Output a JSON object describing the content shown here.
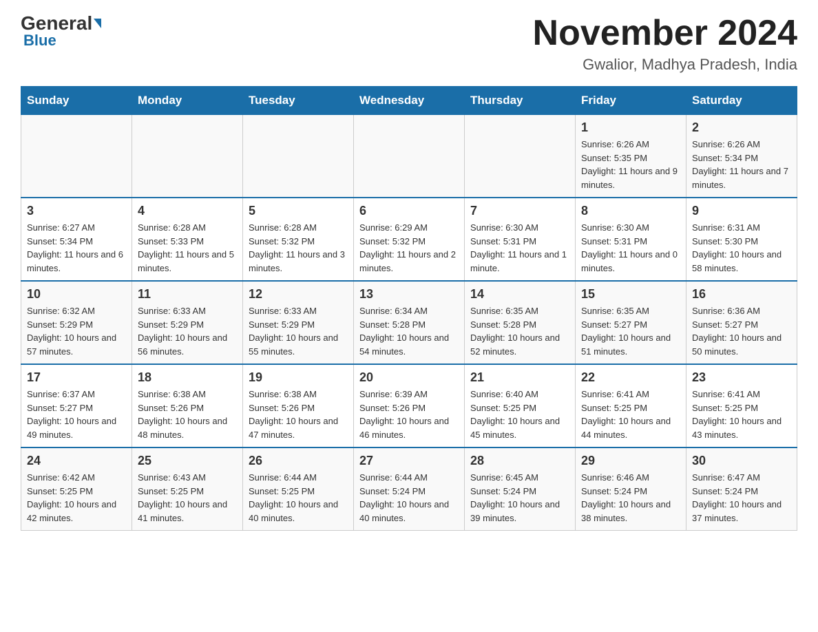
{
  "header": {
    "logo_general": "General",
    "logo_blue": "Blue",
    "month_title": "November 2024",
    "location": "Gwalior, Madhya Pradesh, India"
  },
  "days_of_week": [
    "Sunday",
    "Monday",
    "Tuesday",
    "Wednesday",
    "Thursday",
    "Friday",
    "Saturday"
  ],
  "weeks": [
    [
      {
        "day": "",
        "info": ""
      },
      {
        "day": "",
        "info": ""
      },
      {
        "day": "",
        "info": ""
      },
      {
        "day": "",
        "info": ""
      },
      {
        "day": "",
        "info": ""
      },
      {
        "day": "1",
        "info": "Sunrise: 6:26 AM\nSunset: 5:35 PM\nDaylight: 11 hours and 9 minutes."
      },
      {
        "day": "2",
        "info": "Sunrise: 6:26 AM\nSunset: 5:34 PM\nDaylight: 11 hours and 7 minutes."
      }
    ],
    [
      {
        "day": "3",
        "info": "Sunrise: 6:27 AM\nSunset: 5:34 PM\nDaylight: 11 hours and 6 minutes."
      },
      {
        "day": "4",
        "info": "Sunrise: 6:28 AM\nSunset: 5:33 PM\nDaylight: 11 hours and 5 minutes."
      },
      {
        "day": "5",
        "info": "Sunrise: 6:28 AM\nSunset: 5:32 PM\nDaylight: 11 hours and 3 minutes."
      },
      {
        "day": "6",
        "info": "Sunrise: 6:29 AM\nSunset: 5:32 PM\nDaylight: 11 hours and 2 minutes."
      },
      {
        "day": "7",
        "info": "Sunrise: 6:30 AM\nSunset: 5:31 PM\nDaylight: 11 hours and 1 minute."
      },
      {
        "day": "8",
        "info": "Sunrise: 6:30 AM\nSunset: 5:31 PM\nDaylight: 11 hours and 0 minutes."
      },
      {
        "day": "9",
        "info": "Sunrise: 6:31 AM\nSunset: 5:30 PM\nDaylight: 10 hours and 58 minutes."
      }
    ],
    [
      {
        "day": "10",
        "info": "Sunrise: 6:32 AM\nSunset: 5:29 PM\nDaylight: 10 hours and 57 minutes."
      },
      {
        "day": "11",
        "info": "Sunrise: 6:33 AM\nSunset: 5:29 PM\nDaylight: 10 hours and 56 minutes."
      },
      {
        "day": "12",
        "info": "Sunrise: 6:33 AM\nSunset: 5:29 PM\nDaylight: 10 hours and 55 minutes."
      },
      {
        "day": "13",
        "info": "Sunrise: 6:34 AM\nSunset: 5:28 PM\nDaylight: 10 hours and 54 minutes."
      },
      {
        "day": "14",
        "info": "Sunrise: 6:35 AM\nSunset: 5:28 PM\nDaylight: 10 hours and 52 minutes."
      },
      {
        "day": "15",
        "info": "Sunrise: 6:35 AM\nSunset: 5:27 PM\nDaylight: 10 hours and 51 minutes."
      },
      {
        "day": "16",
        "info": "Sunrise: 6:36 AM\nSunset: 5:27 PM\nDaylight: 10 hours and 50 minutes."
      }
    ],
    [
      {
        "day": "17",
        "info": "Sunrise: 6:37 AM\nSunset: 5:27 PM\nDaylight: 10 hours and 49 minutes."
      },
      {
        "day": "18",
        "info": "Sunrise: 6:38 AM\nSunset: 5:26 PM\nDaylight: 10 hours and 48 minutes."
      },
      {
        "day": "19",
        "info": "Sunrise: 6:38 AM\nSunset: 5:26 PM\nDaylight: 10 hours and 47 minutes."
      },
      {
        "day": "20",
        "info": "Sunrise: 6:39 AM\nSunset: 5:26 PM\nDaylight: 10 hours and 46 minutes."
      },
      {
        "day": "21",
        "info": "Sunrise: 6:40 AM\nSunset: 5:25 PM\nDaylight: 10 hours and 45 minutes."
      },
      {
        "day": "22",
        "info": "Sunrise: 6:41 AM\nSunset: 5:25 PM\nDaylight: 10 hours and 44 minutes."
      },
      {
        "day": "23",
        "info": "Sunrise: 6:41 AM\nSunset: 5:25 PM\nDaylight: 10 hours and 43 minutes."
      }
    ],
    [
      {
        "day": "24",
        "info": "Sunrise: 6:42 AM\nSunset: 5:25 PM\nDaylight: 10 hours and 42 minutes."
      },
      {
        "day": "25",
        "info": "Sunrise: 6:43 AM\nSunset: 5:25 PM\nDaylight: 10 hours and 41 minutes."
      },
      {
        "day": "26",
        "info": "Sunrise: 6:44 AM\nSunset: 5:25 PM\nDaylight: 10 hours and 40 minutes."
      },
      {
        "day": "27",
        "info": "Sunrise: 6:44 AM\nSunset: 5:24 PM\nDaylight: 10 hours and 40 minutes."
      },
      {
        "day": "28",
        "info": "Sunrise: 6:45 AM\nSunset: 5:24 PM\nDaylight: 10 hours and 39 minutes."
      },
      {
        "day": "29",
        "info": "Sunrise: 6:46 AM\nSunset: 5:24 PM\nDaylight: 10 hours and 38 minutes."
      },
      {
        "day": "30",
        "info": "Sunrise: 6:47 AM\nSunset: 5:24 PM\nDaylight: 10 hours and 37 minutes."
      }
    ]
  ]
}
